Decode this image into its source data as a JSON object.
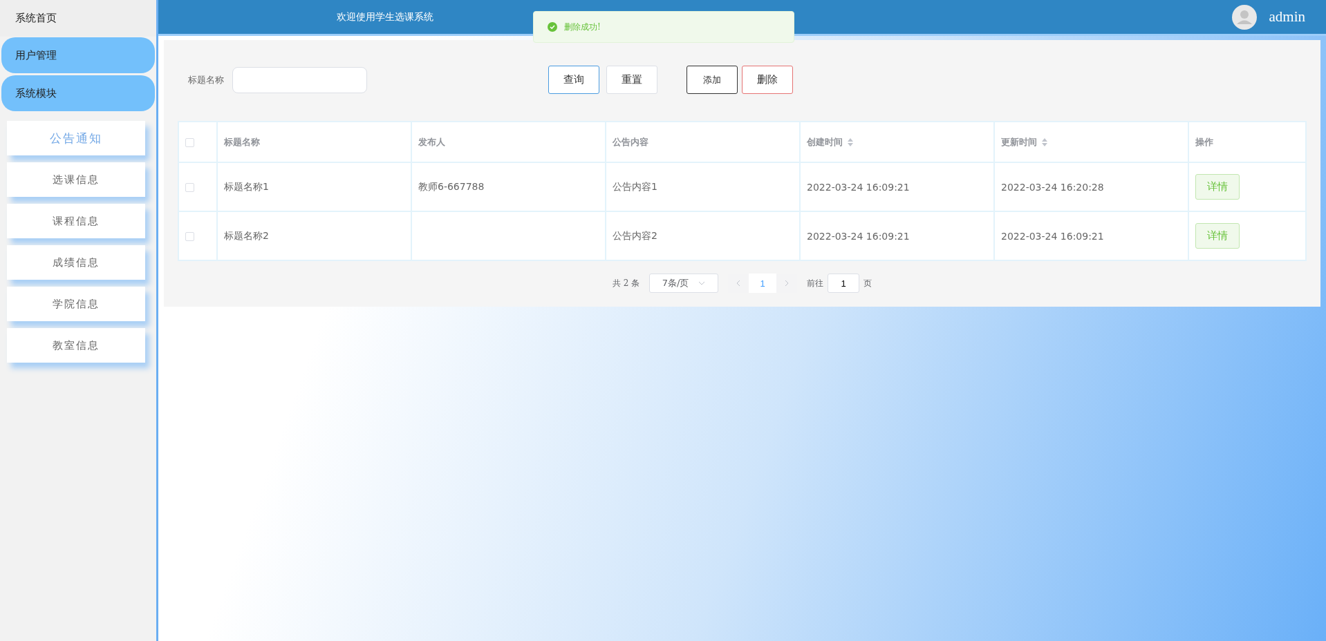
{
  "sidebar": {
    "home": "系统首页",
    "groups": [
      "用户管理",
      "系统模块"
    ],
    "items": [
      {
        "label": "公告通知",
        "selected": true
      },
      {
        "label": "选课信息",
        "selected": false
      },
      {
        "label": "课程信息",
        "selected": false
      },
      {
        "label": "成绩信息",
        "selected": false
      },
      {
        "label": "学院信息",
        "selected": false
      },
      {
        "label": "教室信息",
        "selected": false
      }
    ]
  },
  "header": {
    "title": "欢迎使用学生选课系统",
    "user": "admin"
  },
  "toast": {
    "kind": "success",
    "message": "删除成功!"
  },
  "search": {
    "label": "标题名称"
  },
  "buttons": [
    {
      "label": "查询",
      "kind": "primary"
    },
    {
      "label": "重置",
      "kind": "plain"
    },
    {
      "label": "添加",
      "kind": "dark"
    },
    {
      "label": "删除",
      "kind": "danger"
    }
  ],
  "table": {
    "columns": [
      {
        "label": "标题名称",
        "sortable": false
      },
      {
        "label": "发布人",
        "sortable": false
      },
      {
        "label": "公告内容",
        "sortable": false
      },
      {
        "label": "创建时间",
        "sortable": true
      },
      {
        "label": "更新时间",
        "sortable": true
      },
      {
        "label": "操作",
        "sortable": false
      }
    ],
    "header_checked": false,
    "rows": [
      {
        "checked": false,
        "cells": [
          "标题名称1",
          "教师6-667788",
          "公告内容1",
          "2022-03-24 16:09:21",
          "2022-03-24 16:20:28"
        ],
        "action": "详情"
      },
      {
        "checked": false,
        "cells": [
          "标题名称2",
          "",
          "公告内容2",
          "2022-03-24 16:09:21",
          "2022-03-24 16:09:21"
        ],
        "action": "详情"
      }
    ]
  },
  "pagination": {
    "total": "共 2 条",
    "page_size": "7条/页",
    "pages": [
      {
        "label": "1",
        "selected": true
      }
    ],
    "goto_label": "前往",
    "goto_value": "1",
    "goto_suffix": "页"
  }
}
